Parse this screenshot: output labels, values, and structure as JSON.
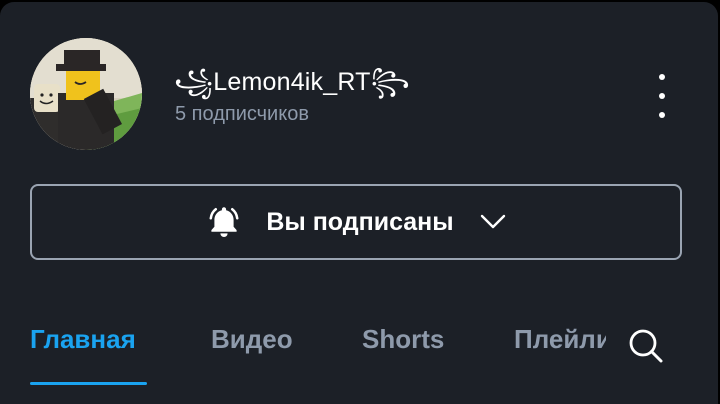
{
  "channel": {
    "name": "꧁Lemon4ik_RT꧂",
    "subscribers": "5 подписчиков"
  },
  "subscribe_button": {
    "label": "Вы подписаны",
    "icon": "bell-icon",
    "dropdown_icon": "chevron-down-icon"
  },
  "tabs": [
    {
      "label": "Главная",
      "active": true
    },
    {
      "label": "Видео",
      "active": false
    },
    {
      "label": "Shorts",
      "active": false
    },
    {
      "label": "Плейлисты",
      "active": false
    }
  ],
  "icons": {
    "menu": "more-vertical-icon",
    "search": "search-icon"
  },
  "colors": {
    "background": "#1c2027",
    "accent": "#1aa3f0",
    "muted_text": "#8e9aab",
    "button_border": "#9aa4b2"
  }
}
